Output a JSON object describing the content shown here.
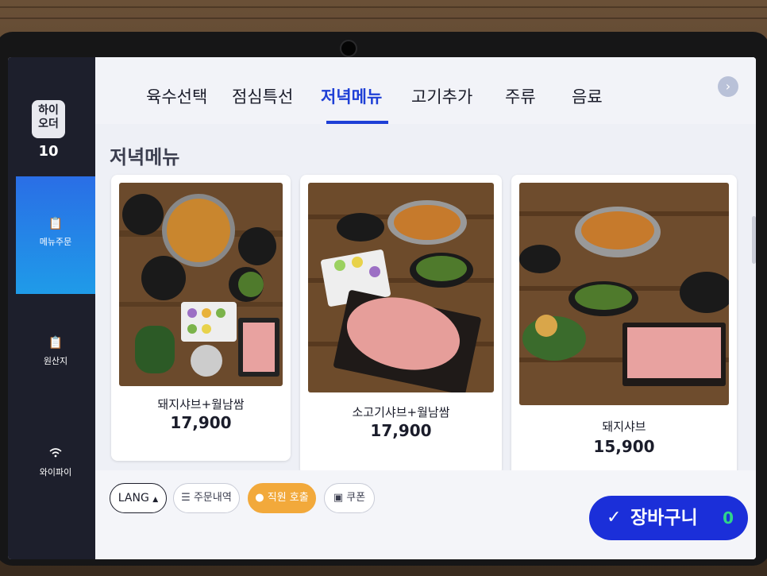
{
  "sidebar": {
    "brand": "하이\n오더",
    "table_number": "10",
    "items": [
      {
        "label": "메뉴주문",
        "icon": "clipboard-icon"
      },
      {
        "label": "원산지",
        "icon": "clipboard-check-icon"
      },
      {
        "label": "와이파이",
        "icon": "wifi-icon"
      }
    ]
  },
  "tabs": [
    "육수선택",
    "점심특선",
    "저녁메뉴",
    "고기추가",
    "주류",
    "음료"
  ],
  "active_tab": "저녁메뉴",
  "section_title": "저녁메뉴",
  "menu_items": [
    {
      "name": "돼지샤브+월남쌈",
      "price": "17,900"
    },
    {
      "name": "소고기샤브+월남쌈",
      "price": "17,900"
    },
    {
      "name": "돼지샤브",
      "price": "15,900"
    }
  ],
  "bottom": {
    "lang": "LANG",
    "order_history": "주문내역",
    "call_staff": "직원 호출",
    "coupon": "쿠폰",
    "cart_label": "장바구니",
    "cart_count": "0"
  },
  "colors": {
    "accent": "#1e3fd6",
    "cart": "#1b2fd9",
    "staff_call": "#f2a93b",
    "cart_count": "#2fd48a"
  }
}
